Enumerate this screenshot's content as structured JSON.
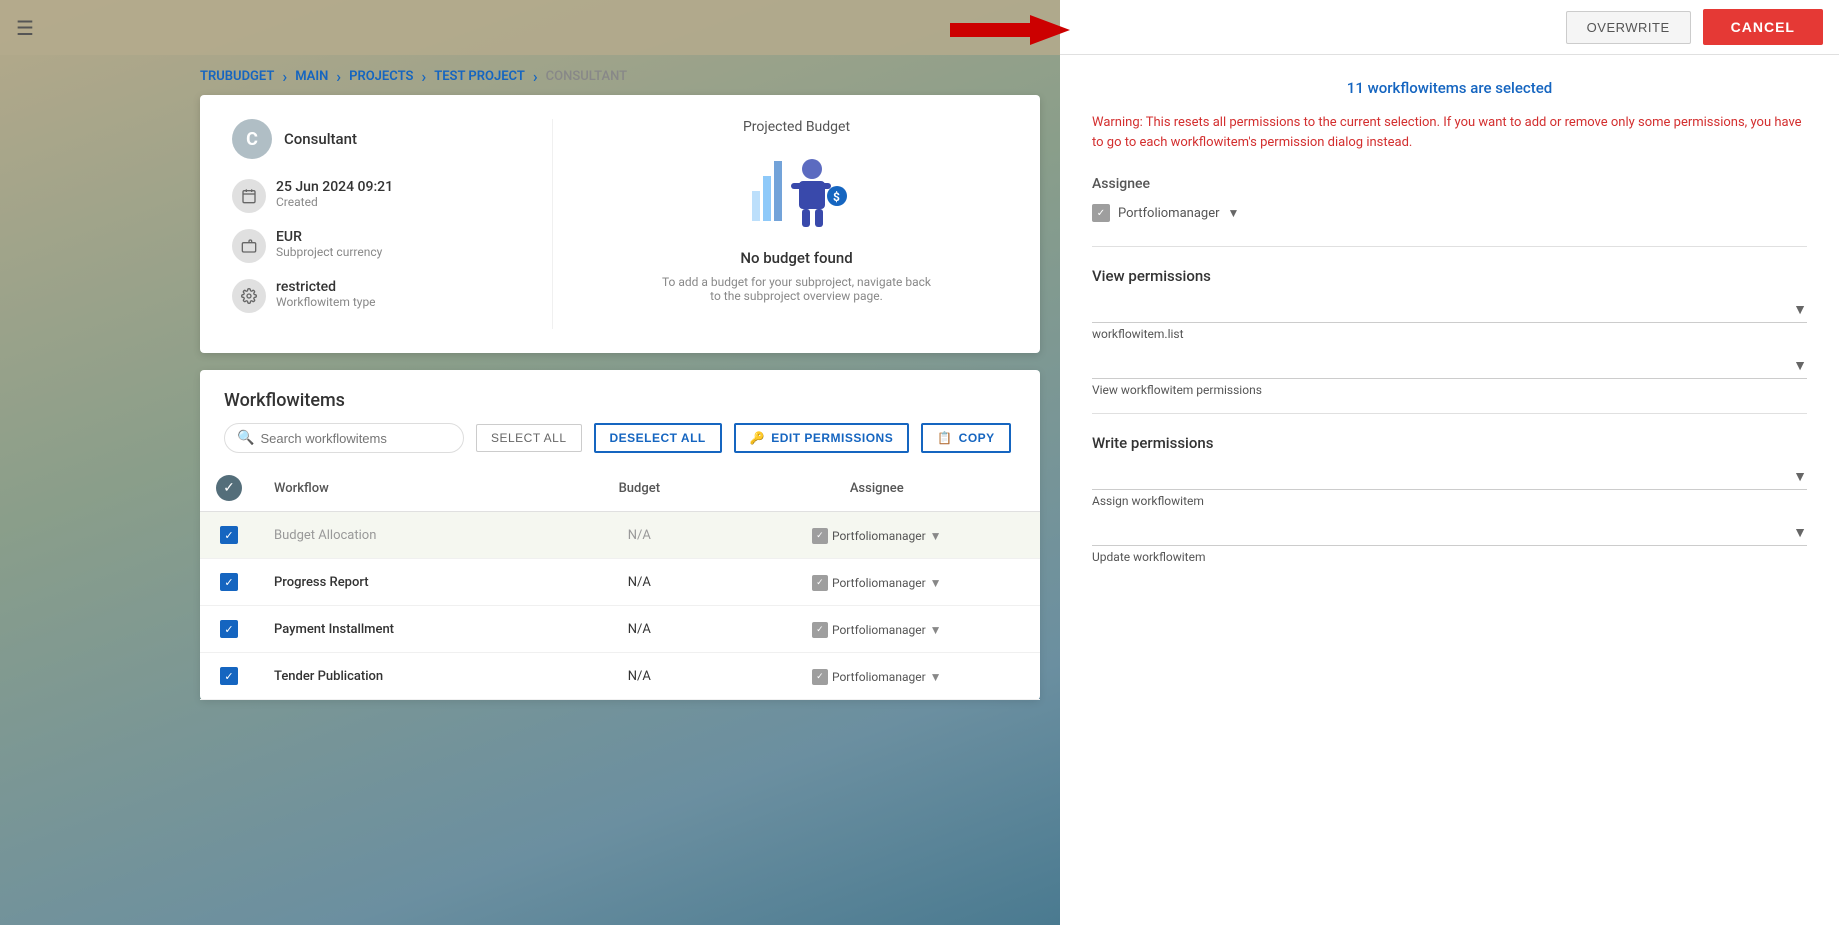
{
  "app": {
    "title": "TruBudget"
  },
  "breadcrumb": {
    "items": [
      "TRUBUDGET",
      "MAIN",
      "PROJECTS",
      "TEST PROJECT",
      "CONSULTANT"
    ],
    "separators": [
      "›",
      "›",
      "›",
      "›"
    ]
  },
  "subproject": {
    "avatar_letter": "C",
    "name": "Consultant",
    "created_date": "25 Jun 2024 09:21",
    "created_label": "Created",
    "currency": "EUR",
    "currency_label": "Subproject currency",
    "wf_type": "restricted",
    "wf_type_label": "Workflowitem type",
    "projected_budget_title": "Projected Budget",
    "no_budget_text": "No budget found",
    "no_budget_sub": "To add a budget for your subproject, navigate back to the subproject overview page."
  },
  "workflowitems": {
    "title": "Workflowitems",
    "search_placeholder": "Search workflowitems",
    "buttons": {
      "select_all": "SELECT ALL",
      "deselect_all": "DESELECT ALL",
      "edit_permissions": "EDIT PERMISSIONS",
      "copy": "COPY"
    },
    "columns": {
      "workflow": "Workflow",
      "budget": "Budget",
      "assignee": "Assignee"
    },
    "rows": [
      {
        "name": "Budget Allocation",
        "budget": "N/A",
        "assignee": "Portfoliomanager",
        "checked": true,
        "highlighted": true
      },
      {
        "name": "Progress Report",
        "budget": "N/A",
        "assignee": "Portfoliomanager",
        "checked": true,
        "highlighted": false
      },
      {
        "name": "Payment Installment",
        "budget": "N/A",
        "assignee": "Portfoliomanager",
        "checked": true,
        "highlighted": false
      },
      {
        "name": "Tender Publication",
        "budget": "N/A",
        "assignee": "Portfoliomanager",
        "checked": true,
        "highlighted": false
      }
    ]
  },
  "right_panel": {
    "selected_count_text": "11 workflowitems are selected",
    "warning_text": "Warning: This resets all permissions to the current selection. If you want to add or remove only some permissions, you have to go to each workflowitem's permission dialog instead.",
    "assignee_label": "Assignee",
    "assignee_value": "Portfoliomanager",
    "view_permissions_title": "View permissions",
    "view_permissions_items": [
      {
        "label": "workflowitem.list"
      },
      {
        "label": "View workflowitem permissions"
      }
    ],
    "write_permissions_title": "Write permissions",
    "write_permissions_items": [
      {
        "label": "Assign workflowitem"
      },
      {
        "label": "Update workflowitem"
      }
    ]
  },
  "toolbar": {
    "overwrite_label": "OVERWRITE",
    "cancel_label": "CANCEL"
  }
}
